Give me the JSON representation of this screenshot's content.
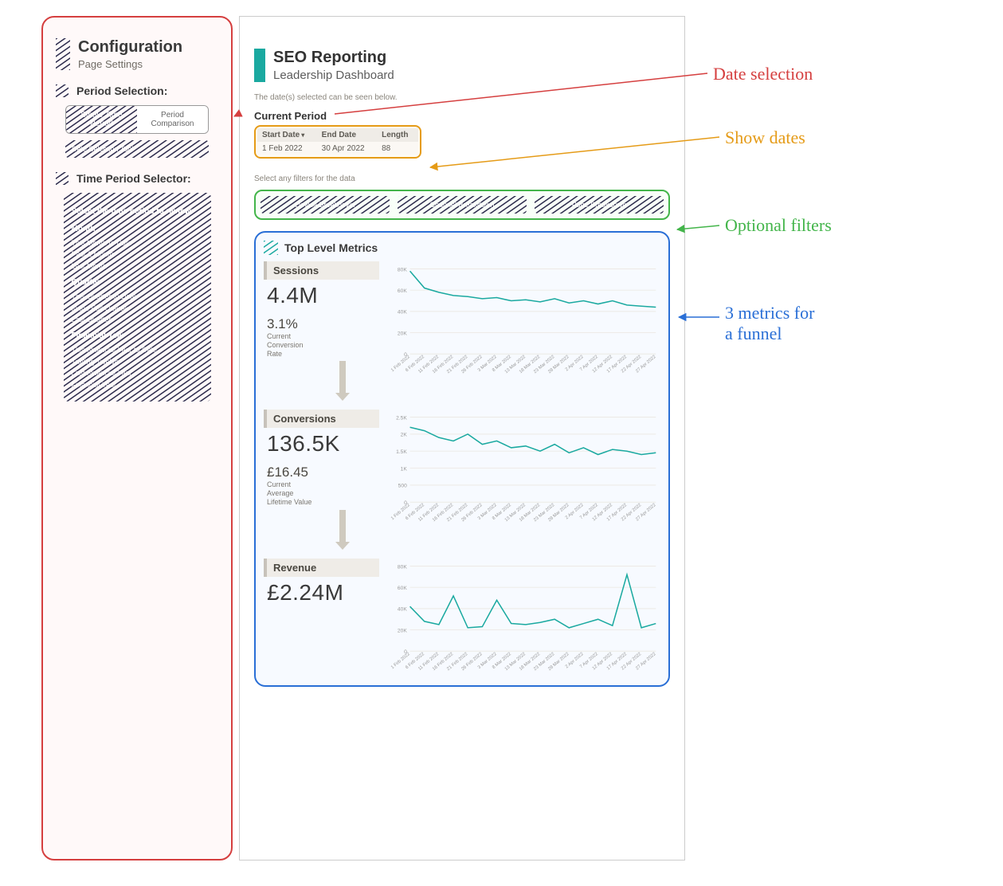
{
  "annotations": {
    "date_selection": "Date selection",
    "show_dates": "Show dates",
    "optional_filters": "Optional filters",
    "metrics_funnel": "3 metrics for\na funnel"
  },
  "sidebar": {
    "title": "Configuration",
    "subtitle": "Page Settings",
    "period_selection_label": "Period Selection:",
    "toggle": {
      "single": "Single Time Period",
      "compare": "Period Comparison"
    },
    "date_select_text": "Date Selection Tool",
    "time_period_label": "Time Period Selector:",
    "selector": {
      "heading": "Select the time period to review:",
      "groups": [
        {
          "name": "Month",
          "items": [
            "This Month to Date",
            "Past 1 Month",
            "Last Month"
          ]
        },
        {
          "name": "Quarter",
          "items": [
            "This Quarter to Date",
            "In the Full Quarter",
            "Last Quarter"
          ]
        },
        {
          "name": "Financial Year",
          "items": [
            "This Financial Year to Date",
            "Trailing Twelve",
            "Last Financial Year",
            "Financial Year"
          ]
        }
      ]
    }
  },
  "main": {
    "title": "SEO Reporting",
    "subtitle": "Leadership Dashboard",
    "dates_note": "The date(s) selected can be seen below.",
    "current_period_label": "Current Period",
    "date_table": {
      "headers": [
        "Start Date",
        "End Date",
        "Length"
      ],
      "row": [
        "1 Feb 2022",
        "30 Apr 2022",
        "88"
      ]
    },
    "filters_note": "Select any filters for the data",
    "filters": [
      "Device Breakdown",
      "Channel Breakdown",
      "Page Breakdown"
    ],
    "top_level_label": "Top Level Metrics",
    "metrics": [
      {
        "name": "Sessions",
        "value": "4.4M",
        "mid_value": "3.1%",
        "mid_label": "Current\nConversion\nRate"
      },
      {
        "name": "Conversions",
        "value": "136.5K",
        "mid_value": "£16.45",
        "mid_label": "Current\nAverage\nLifetime Value"
      },
      {
        "name": "Revenue",
        "value": "£2.24M",
        "mid_value": "",
        "mid_label": ""
      }
    ]
  },
  "chart_data": [
    {
      "type": "line",
      "title": "Sessions",
      "xlabel": "",
      "ylabel": "",
      "ylim": [
        0,
        80000
      ],
      "yticks": [
        0,
        20000,
        40000,
        60000,
        80000
      ],
      "ytick_labels": [
        "0",
        "20K",
        "40K",
        "60K",
        "80K"
      ],
      "x": [
        "1 Feb 2022",
        "6 Feb 2022",
        "11 Feb 2022",
        "16 Feb 2022",
        "21 Feb 2022",
        "26 Feb 2022",
        "3 Mar 2022",
        "8 Mar 2022",
        "13 Mar 2022",
        "18 Mar 2022",
        "23 Mar 2022",
        "28 Mar 2022",
        "2 Apr 2022",
        "7 Apr 2022",
        "12 Apr 2022",
        "17 Apr 2022",
        "22 Apr 2022",
        "27 Apr 2022"
      ],
      "values": [
        78000,
        62000,
        58000,
        55000,
        54000,
        52000,
        53000,
        50000,
        51000,
        49000,
        52000,
        48000,
        50000,
        47000,
        50000,
        46000,
        45000,
        44000
      ]
    },
    {
      "type": "line",
      "title": "Conversions",
      "xlabel": "",
      "ylabel": "",
      "ylim": [
        0,
        2500
      ],
      "yticks": [
        0,
        500,
        1000,
        1500,
        2000,
        2500
      ],
      "ytick_labels": [
        "0",
        "500",
        "1K",
        "1.5K",
        "2K",
        "2.5K"
      ],
      "x": [
        "1 Feb 2022",
        "6 Feb 2022",
        "11 Feb 2022",
        "16 Feb 2022",
        "21 Feb 2022",
        "26 Feb 2022",
        "3 Mar 2022",
        "8 Mar 2022",
        "13 Mar 2022",
        "18 Mar 2022",
        "23 Mar 2022",
        "28 Mar 2022",
        "2 Apr 2022",
        "7 Apr 2022",
        "12 Apr 2022",
        "17 Apr 2022",
        "22 Apr 2022",
        "27 Apr 2022"
      ],
      "values": [
        2200,
        2100,
        1900,
        1800,
        2000,
        1700,
        1800,
        1600,
        1650,
        1500,
        1700,
        1450,
        1600,
        1400,
        1550,
        1500,
        1400,
        1450
      ]
    },
    {
      "type": "line",
      "title": "Revenue",
      "xlabel": "",
      "ylabel": "",
      "ylim": [
        0,
        80000
      ],
      "yticks": [
        0,
        20000,
        40000,
        60000,
        80000
      ],
      "ytick_labels": [
        "0",
        "20K",
        "40K",
        "60K",
        "80K"
      ],
      "x": [
        "1 Feb 2022",
        "6 Feb 2022",
        "11 Feb 2022",
        "16 Feb 2022",
        "21 Feb 2022",
        "26 Feb 2022",
        "3 Mar 2022",
        "8 Mar 2022",
        "13 Mar 2022",
        "18 Mar 2022",
        "23 Mar 2022",
        "28 Mar 2022",
        "2 Apr 2022",
        "7 Apr 2022",
        "12 Apr 2022",
        "17 Apr 2022",
        "22 Apr 2022",
        "27 Apr 2022"
      ],
      "values": [
        42000,
        28000,
        25000,
        52000,
        22000,
        23000,
        48000,
        26000,
        25000,
        27000,
        30000,
        22000,
        26000,
        30000,
        24000,
        72000,
        22000,
        26000
      ]
    }
  ]
}
